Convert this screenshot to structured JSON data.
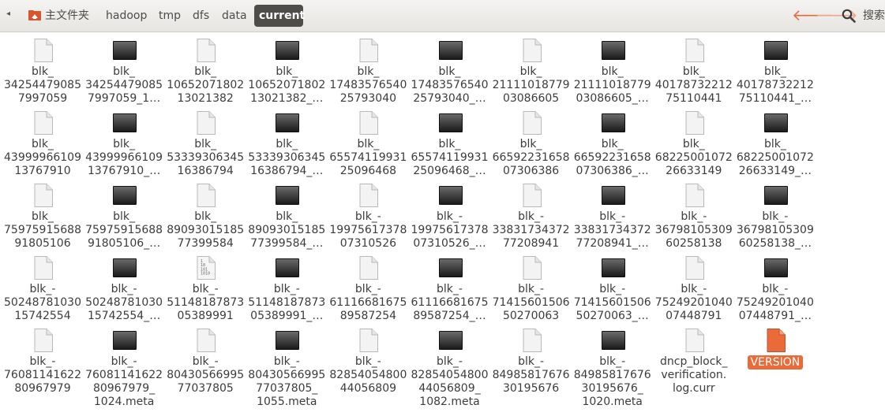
{
  "toolbar": {
    "breadcrumbs": [
      "主文件夹",
      "hadoop",
      "tmp",
      "dfs",
      "data",
      "current"
    ],
    "search_label": "搜索",
    "accent": "#e96b3a"
  },
  "files": [
    {
      "kind": "file",
      "name": "blk_\n34254479085\n7997059"
    },
    {
      "kind": "dark",
      "name": "blk_\n34254479085\n7997059_1…"
    },
    {
      "kind": "file",
      "name": "blk_\n10652071802\n13021382"
    },
    {
      "kind": "dark",
      "name": "blk_\n10652071802\n13021382_…"
    },
    {
      "kind": "file",
      "name": "blk_\n17483576540\n25793040"
    },
    {
      "kind": "dark",
      "name": "blk_\n17483576540\n25793040_…"
    },
    {
      "kind": "file",
      "name": "blk_\n21111018779\n03086605"
    },
    {
      "kind": "dark",
      "name": "blk_\n21111018779\n03086605_…"
    },
    {
      "kind": "file",
      "name": "blk_\n40178732212\n75110441"
    },
    {
      "kind": "dark",
      "name": "blk_\n40178732212\n75110441_…"
    },
    {
      "kind": "file",
      "name": "blk_\n43999966109\n13767910"
    },
    {
      "kind": "dark",
      "name": "blk_\n43999966109\n13767910_…"
    },
    {
      "kind": "file",
      "name": "blk_\n53339306345\n16386794"
    },
    {
      "kind": "dark",
      "name": "blk_\n53339306345\n16386794_…"
    },
    {
      "kind": "file",
      "name": "blk_\n65574119931\n25096468"
    },
    {
      "kind": "dark",
      "name": "blk_\n65574119931\n25096468_…"
    },
    {
      "kind": "file",
      "name": "blk_\n66592231658\n07306386"
    },
    {
      "kind": "dark",
      "name": "blk_\n66592231658\n07306386_…"
    },
    {
      "kind": "file",
      "name": "blk_\n68225001072\n26633149"
    },
    {
      "kind": "dark",
      "name": "blk_\n68225001072\n26633149_…"
    },
    {
      "kind": "file",
      "name": "blk_\n75975915688\n91805106"
    },
    {
      "kind": "dark",
      "name": "blk_\n75975915688\n91805106_…"
    },
    {
      "kind": "file",
      "name": "blk_\n89093015185\n77399584"
    },
    {
      "kind": "dark",
      "name": "blk_\n89093015185\n77399584_…"
    },
    {
      "kind": "file",
      "name": "blk_-\n19975617378\n07310526"
    },
    {
      "kind": "dark",
      "name": "blk_-\n19975617378\n07310526_…"
    },
    {
      "kind": "file",
      "name": "blk_-\n33831734372\n77208941"
    },
    {
      "kind": "dark",
      "name": "blk_-\n33831734372\n77208941_…"
    },
    {
      "kind": "file",
      "name": "blk_-\n36798105309\n60258138"
    },
    {
      "kind": "dark",
      "name": "blk_-\n36798105309\n60258138_…"
    },
    {
      "kind": "file",
      "name": "blk_-\n50248781030\n15742554"
    },
    {
      "kind": "dark",
      "name": "blk_-\n50248781030\n15742554_…"
    },
    {
      "kind": "bin",
      "name": "blk_-\n51148187873\n05389991"
    },
    {
      "kind": "dark",
      "name": "blk_-\n51148187873\n05389991_…"
    },
    {
      "kind": "file",
      "name": "blk_-\n61116681675\n89587254"
    },
    {
      "kind": "dark",
      "name": "blk_-\n61116681675\n89587254_…"
    },
    {
      "kind": "file",
      "name": "blk_-\n71415601506\n50270063"
    },
    {
      "kind": "dark",
      "name": "blk_-\n71415601506\n50270063_…"
    },
    {
      "kind": "file",
      "name": "blk_-\n75249201040\n07448791"
    },
    {
      "kind": "dark",
      "name": "blk_-\n75249201040\n07448791_…"
    },
    {
      "kind": "file",
      "name": "blk_-\n76081141622\n80967979"
    },
    {
      "kind": "dark",
      "name": "blk_-\n76081141622\n80967979_\n1024.meta"
    },
    {
      "kind": "file",
      "name": "blk_-\n80430566995\n77037805"
    },
    {
      "kind": "dark",
      "name": "blk_-\n80430566995\n77037805_\n1055.meta"
    },
    {
      "kind": "file",
      "name": "blk_-\n82854054800\n44056809"
    },
    {
      "kind": "dark",
      "name": "blk_-\n82854054800\n44056809_\n1082.meta"
    },
    {
      "kind": "file",
      "name": "blk_-\n84985817676\n30195676"
    },
    {
      "kind": "dark",
      "name": "blk_-\n84985817676\n30195676_\n1020.meta"
    },
    {
      "kind": "file",
      "name": "dncp_block_\nverification.\nlog.curr"
    },
    {
      "kind": "version",
      "name": "VERSION",
      "selected": true
    }
  ],
  "bin_icon_text": [
    "1",
    "10",
    "101",
    "1010"
  ]
}
